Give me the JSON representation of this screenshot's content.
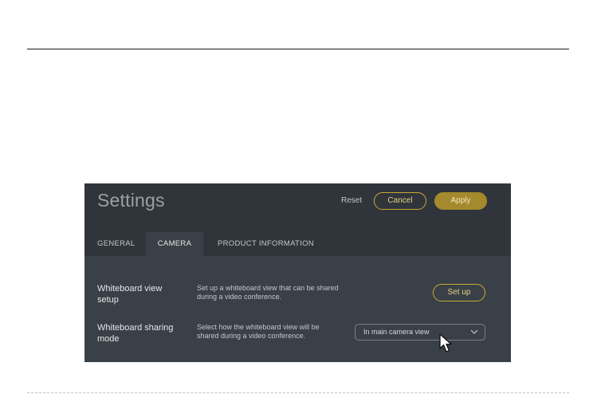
{
  "settings": {
    "title": "Settings",
    "header_actions": {
      "reset_label": "Reset",
      "cancel_label": "Cancel",
      "apply_label": "Apply"
    },
    "tabs": [
      {
        "label": "GENERAL",
        "active": false
      },
      {
        "label": "CAMERA",
        "active": true
      },
      {
        "label": "PRODUCT INFORMATION",
        "active": false
      }
    ],
    "rows": [
      {
        "label": "Whiteboard view setup",
        "description": "Set up a whiteboard view that can be shared during a video conference.",
        "control_label": "Set up"
      },
      {
        "label": "Whiteboard sharing mode",
        "description": "Select how the whiteboard view will be shared during a video conference.",
        "selected_value": "In main camera view"
      }
    ],
    "colors": {
      "panel_bg": "#3a4047",
      "header_bg": "#30353b",
      "accent": "#c9a934",
      "apply_fill": "#a48a2c"
    },
    "icons": [
      "chevron-down-icon",
      "mouse-pointer-icon"
    ]
  }
}
